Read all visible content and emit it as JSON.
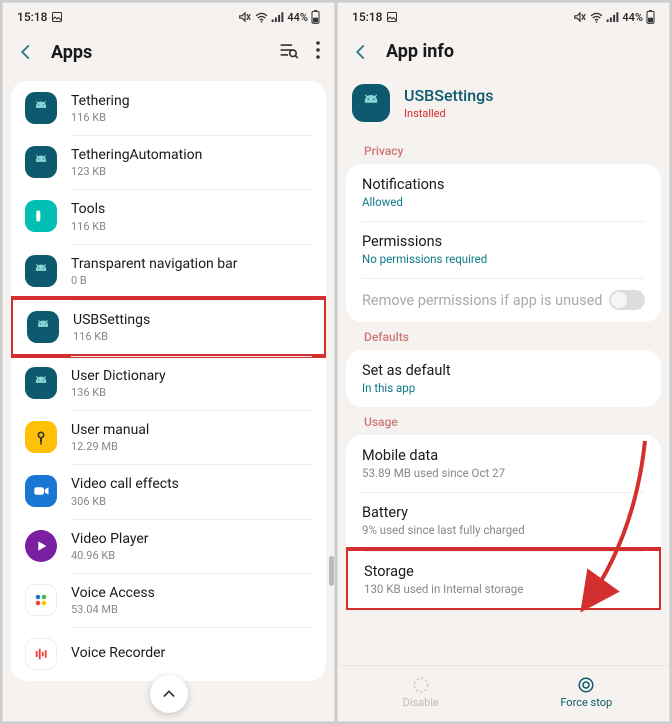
{
  "status": {
    "time": "15:18",
    "battery": "44%"
  },
  "left": {
    "title": "Apps",
    "apps": [
      {
        "name": "Tethering",
        "size": "116 KB",
        "icon": "android"
      },
      {
        "name": "TetheringAutomation",
        "size": "123 KB",
        "icon": "android"
      },
      {
        "name": "Tools",
        "size": "116 KB",
        "icon": "tools"
      },
      {
        "name": "Transparent navigation bar",
        "size": "0 B",
        "icon": "android"
      },
      {
        "name": "USBSettings",
        "size": "116 KB",
        "icon": "android",
        "highlight": true
      },
      {
        "name": "User Dictionary",
        "size": "136 KB",
        "icon": "android"
      },
      {
        "name": "User manual",
        "size": "12.29 MB",
        "icon": "manual"
      },
      {
        "name": "Video call effects",
        "size": "306 KB",
        "icon": "video"
      },
      {
        "name": "Video Player",
        "size": "40.96 KB",
        "icon": "player"
      },
      {
        "name": "Voice Access",
        "size": "53.04 MB",
        "icon": "voice"
      },
      {
        "name": "Voice Recorder",
        "size": "",
        "icon": "recorder"
      }
    ]
  },
  "right": {
    "title": "App info",
    "app": {
      "name": "USBSettings",
      "status": "Installed"
    },
    "privacy_label": "Privacy",
    "privacy": [
      {
        "title": "Notifications",
        "sub": "Allowed"
      },
      {
        "title": "Permissions",
        "sub": "No permissions required"
      }
    ],
    "remove_perms": "Remove permissions if app is unused",
    "defaults_label": "Defaults",
    "defaults": [
      {
        "title": "Set as default",
        "sub": "In this app"
      }
    ],
    "usage_label": "Usage",
    "usage": [
      {
        "title": "Mobile data",
        "sub": "53.89 MB used since Oct 27"
      },
      {
        "title": "Battery",
        "sub": "9% used since last fully charged"
      },
      {
        "title": "Storage",
        "sub": "130 KB used in Internal storage",
        "highlight": true
      }
    ],
    "buttons": {
      "disable": "Disable",
      "force_stop": "Force stop"
    }
  }
}
